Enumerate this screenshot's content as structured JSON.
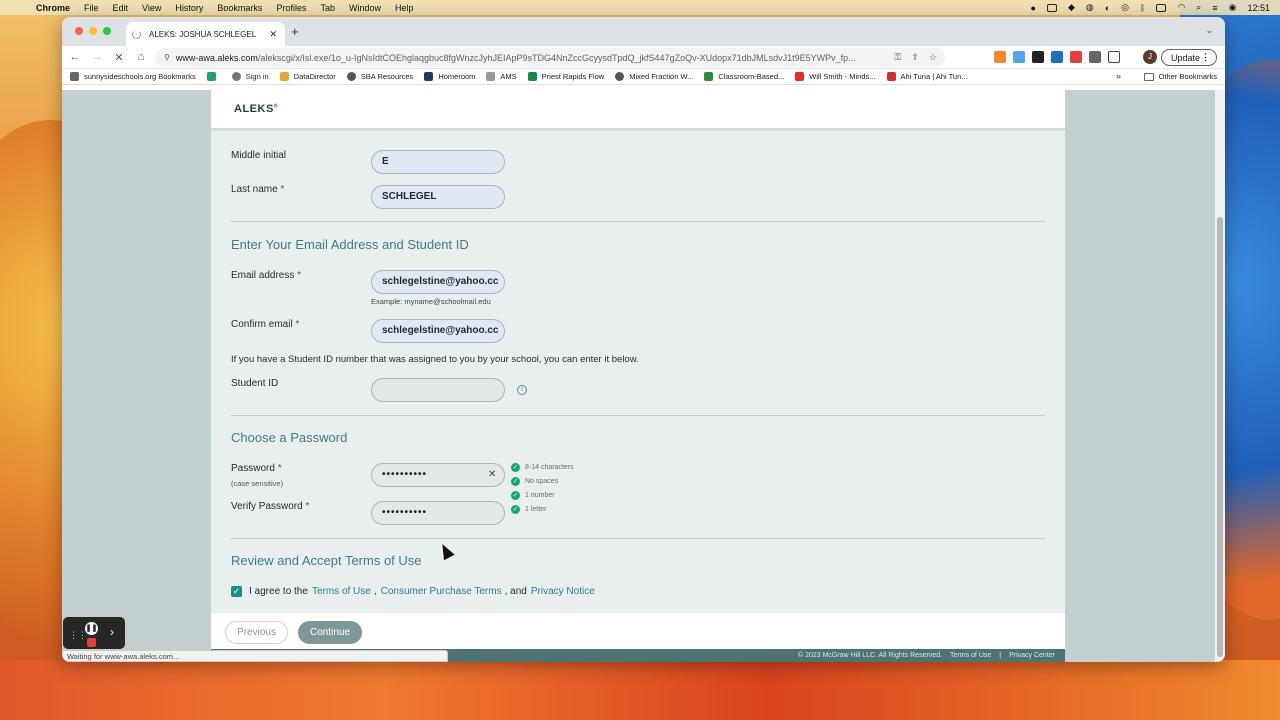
{
  "menubar": {
    "app": "Chrome",
    "items": [
      "File",
      "Edit",
      "View",
      "History",
      "Bookmarks",
      "Profiles",
      "Tab",
      "Window",
      "Help"
    ],
    "clock": "12:51"
  },
  "browser": {
    "tab_title": "ALEKS: JOSHUA SCHLEGEL",
    "url_host": "www-awa.aleks.com",
    "url_path": "/alekscgi/x/Isl.exe/1o_u-IgNsIdtCOEhglaqgbuc8fgWnzcJyhJEIApP9sTDG4NnZccGcyysdTpdQ_jkfS447gZoQv-XUdopx71dbJMLsdvJ1t9E5YWPv_fp...",
    "update_label": "Update",
    "avatar_letter": "J",
    "bookmarks": [
      "sunnysideschools.org Bookmarks",
      "",
      "Sign in",
      "DataDirector",
      "SBA Resources",
      "Homeroom",
      "AMS",
      "Priest Rapids Flow",
      "Mixed Fraction W...",
      "Classroom-Based...",
      "Will Smith - Minds...",
      "Ahi Tuna | Ahi Tun..."
    ],
    "other_bookmarks": "Other Bookmarks",
    "status_text": "Waiting for www-awa.aleks.com..."
  },
  "page": {
    "logo": "ALEKS",
    "middle_initial_label": "Middle initial",
    "middle_initial_value": "E",
    "last_name_label": "Last name",
    "last_name_value": "SCHLEGEL",
    "required_mark": "*",
    "email_section_title": "Enter Your Email Address and Student ID",
    "email_label": "Email address",
    "email_value": "schlegelstine@yahoo.cc",
    "email_example": "Example: myname@schoolmail.edu",
    "confirm_email_label": "Confirm email",
    "confirm_email_value": "schlegelstine@yahoo.cc",
    "student_id_note": "If you have a Student ID number that was assigned to you by your school, you can enter it below.",
    "student_id_label": "Student ID",
    "student_id_value": "",
    "password_section_title": "Choose a Password",
    "password_label": "Password",
    "password_sub": "(case sensitive)",
    "password_value": "••••••••••",
    "verify_password_label": "Verify Password",
    "verify_password_value": "••••••••••",
    "password_rules": [
      "8-14 characters",
      "No spaces",
      "1 number",
      "1 letter"
    ],
    "terms_section_title": "Review and Accept Terms of Use",
    "agree_prefix": "I agree to the",
    "terms_link": "Terms of Use",
    "purchase_link": "Consumer Purchase Terms",
    "and_text": ", and",
    "privacy_link": "Privacy Notice",
    "previous_button": "Previous",
    "continue_button": "Continue",
    "copyright": "© 2023 McGraw Hill LLC. All Rights Reserved.",
    "footer_terms": "Terms of Use",
    "footer_privacy": "Privacy Center"
  }
}
